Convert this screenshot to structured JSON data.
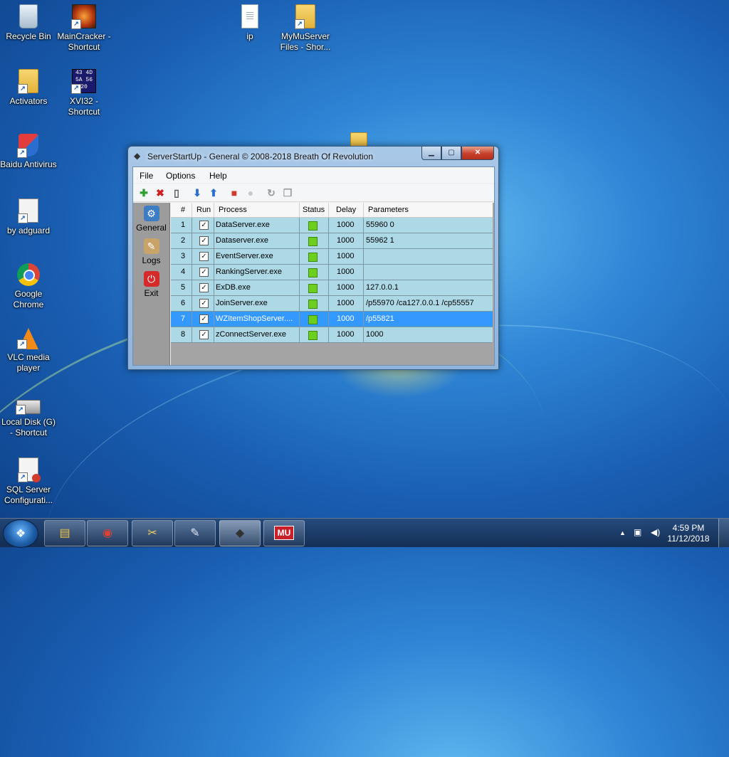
{
  "desktop": {
    "icons": [
      {
        "label": "Recycle Bin",
        "icon": "recycle-bin-icon"
      },
      {
        "label": "MainCracker - Shortcut",
        "icon": "maincracker-icon"
      },
      {
        "label": "ip",
        "icon": "text-file-icon"
      },
      {
        "label": "MyMuServer Files - Shor...",
        "icon": "folder-shortcut-icon"
      },
      {
        "label": "Activators",
        "icon": "folder-shortcut-icon"
      },
      {
        "label": "XVI32 - Shortcut",
        "icon": "hex-editor-icon"
      },
      {
        "label": "Baidu Antivirus",
        "icon": "shield-icon"
      },
      {
        "label": "by adguard",
        "icon": "shortcut-icon"
      },
      {
        "label": "Google Chrome",
        "icon": "chrome-icon"
      },
      {
        "label": "VLC media player",
        "icon": "vlc-cone-icon"
      },
      {
        "label": "Local Disk (G) - Shortcut",
        "icon": "disk-drive-icon"
      },
      {
        "label": "SQL Server Configurati...",
        "icon": "sql-config-icon"
      }
    ]
  },
  "window": {
    "title": "ServerStartUp - General © 2008-2018 Breath Of Revolution",
    "controls": {
      "minimize": "▁",
      "maximize": "▢",
      "close": "✕"
    },
    "menu": [
      "File",
      "Options",
      "Help"
    ],
    "toolbar": [
      {
        "icon": "add-icon",
        "glyph": "✚",
        "color": "#2e9e2e"
      },
      {
        "icon": "delete-icon",
        "glyph": "✖",
        "color": "#d02020"
      },
      {
        "icon": "new-file-icon",
        "glyph": "▯",
        "color": "#555555"
      },
      {
        "icon": "move-down-icon",
        "glyph": "⬇",
        "color": "#2a6fd0"
      },
      {
        "icon": "move-up-icon",
        "glyph": "⬆",
        "color": "#2a6fd0"
      },
      {
        "icon": "stop-icon",
        "glyph": "■",
        "color": "#d03a2a"
      },
      {
        "icon": "lightbulb-icon",
        "glyph": "●",
        "color": "#c8c8c8"
      },
      {
        "icon": "refresh-icon",
        "glyph": "↻",
        "color": "#9a9a9a"
      },
      {
        "icon": "copy-icon",
        "glyph": "❐",
        "color": "#a0a0a0"
      }
    ],
    "sidebar": [
      {
        "label": "General",
        "icon": "gear-icon",
        "glyph": "⚙",
        "color": "#3c7dc4"
      },
      {
        "label": "Logs",
        "icon": "logs-icon",
        "glyph": "✎",
        "color": "#c9a46a"
      },
      {
        "label": "Exit",
        "icon": "power-icon",
        "glyph": "⏻",
        "color": "#d42a2a"
      }
    ],
    "table": {
      "columns": [
        "#",
        "Run",
        "Process",
        "Status",
        "Delay",
        "Parameters"
      ],
      "check_glyph": "✓",
      "rows": [
        {
          "num": "1",
          "run": true,
          "process": "DataServer.exe",
          "status": "running",
          "delay": "1000",
          "params": "55960 0"
        },
        {
          "num": "2",
          "run": true,
          "process": "Dataserver.exe",
          "status": "running",
          "delay": "1000",
          "params": "55962 1"
        },
        {
          "num": "3",
          "run": true,
          "process": "EventServer.exe",
          "status": "running",
          "delay": "1000",
          "params": ""
        },
        {
          "num": "4",
          "run": true,
          "process": "RankingServer.exe",
          "status": "running",
          "delay": "1000",
          "params": ""
        },
        {
          "num": "5",
          "run": true,
          "process": "ExDB.exe",
          "status": "running",
          "delay": "1000",
          "params": "127.0.0.1"
        },
        {
          "num": "6",
          "run": true,
          "process": "JoinServer.exe",
          "status": "running",
          "delay": "1000",
          "params": "/p55970 /ca127.0.0.1 /cp55557"
        },
        {
          "num": "7",
          "run": true,
          "process": "WZItemShopServer....",
          "status": "running",
          "delay": "1000",
          "params": "/p55821"
        },
        {
          "num": "8",
          "run": true,
          "process": "zConnectServer.exe",
          "status": "running",
          "delay": "1000",
          "params": "1000"
        }
      ],
      "selected_row": 7
    }
  },
  "taskbar": {
    "start_glyph": "❖",
    "buttons": [
      {
        "icon": "explorer-folder-icon",
        "glyph": "▤"
      },
      {
        "icon": "chrome-icon",
        "glyph": "◉"
      },
      {
        "icon": "tools-icon",
        "glyph": "✂"
      },
      {
        "icon": "notepad-icon",
        "glyph": "✎"
      },
      {
        "icon": "serverstartup-icon",
        "glyph": "◆"
      },
      {
        "icon": "mu-online-icon",
        "glyph": "MU"
      }
    ],
    "tray": {
      "up_arrow": "▲",
      "network": "▣",
      "volume": "◀)"
    },
    "time": "4:59 PM",
    "date": "11/12/2018"
  }
}
